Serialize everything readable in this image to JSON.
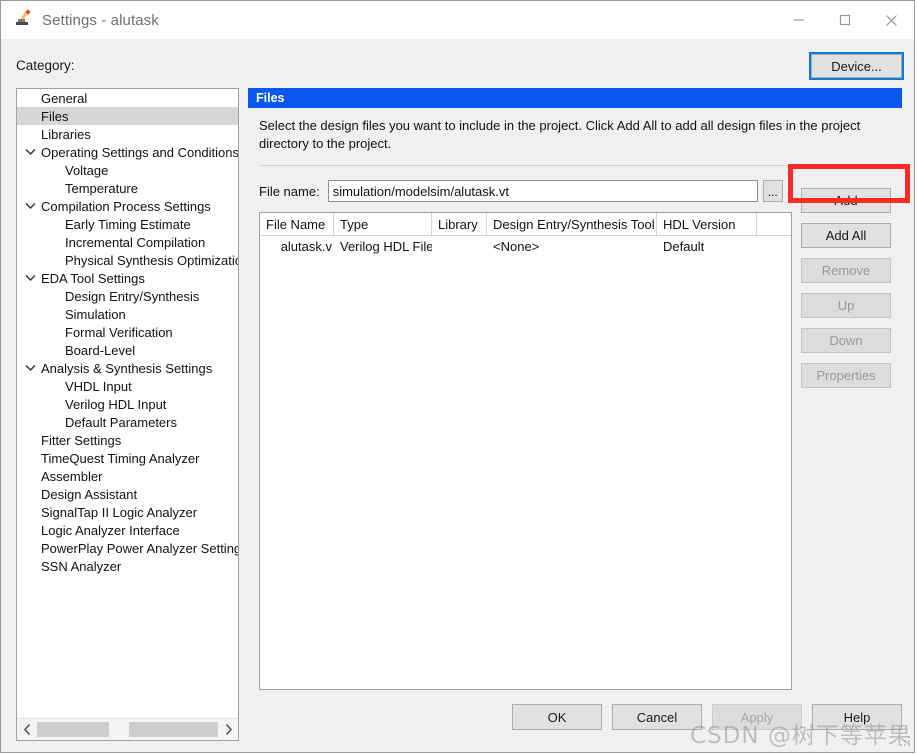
{
  "window": {
    "title": "Settings - alutask",
    "icon": "settings-pencil-icon",
    "minimize_label": "minimize-icon",
    "maximize_label": "maximize-icon",
    "close_label": "close-icon"
  },
  "category": {
    "label": "Category:",
    "items": [
      {
        "label": "General",
        "level": 0,
        "twisty": "none",
        "selected": false
      },
      {
        "label": "Files",
        "level": 0,
        "twisty": "none",
        "selected": true
      },
      {
        "label": "Libraries",
        "level": 0,
        "twisty": "none",
        "selected": false
      },
      {
        "label": "Operating Settings and Conditions",
        "level": 0,
        "twisty": "expanded",
        "selected": false
      },
      {
        "label": "Voltage",
        "level": 1,
        "twisty": "none",
        "selected": false
      },
      {
        "label": "Temperature",
        "level": 1,
        "twisty": "none",
        "selected": false
      },
      {
        "label": "Compilation Process Settings",
        "level": 0,
        "twisty": "expanded",
        "selected": false
      },
      {
        "label": "Early Timing Estimate",
        "level": 1,
        "twisty": "none",
        "selected": false
      },
      {
        "label": "Incremental Compilation",
        "level": 1,
        "twisty": "none",
        "selected": false
      },
      {
        "label": "Physical Synthesis Optimization",
        "level": 1,
        "twisty": "none",
        "selected": false
      },
      {
        "label": "EDA Tool Settings",
        "level": 0,
        "twisty": "expanded",
        "selected": false
      },
      {
        "label": "Design Entry/Synthesis",
        "level": 1,
        "twisty": "none",
        "selected": false
      },
      {
        "label": "Simulation",
        "level": 1,
        "twisty": "none",
        "selected": false
      },
      {
        "label": "Formal Verification",
        "level": 1,
        "twisty": "none",
        "selected": false
      },
      {
        "label": "Board-Level",
        "level": 1,
        "twisty": "none",
        "selected": false
      },
      {
        "label": "Analysis & Synthesis Settings",
        "level": 0,
        "twisty": "expanded",
        "selected": false
      },
      {
        "label": "VHDL Input",
        "level": 1,
        "twisty": "none",
        "selected": false
      },
      {
        "label": "Verilog HDL Input",
        "level": 1,
        "twisty": "none",
        "selected": false
      },
      {
        "label": "Default Parameters",
        "level": 1,
        "twisty": "none",
        "selected": false
      },
      {
        "label": "Fitter Settings",
        "level": 0,
        "twisty": "none",
        "selected": false
      },
      {
        "label": "TimeQuest Timing Analyzer",
        "level": 0,
        "twisty": "none",
        "selected": false
      },
      {
        "label": "Assembler",
        "level": 0,
        "twisty": "none",
        "selected": false
      },
      {
        "label": "Design Assistant",
        "level": 0,
        "twisty": "none",
        "selected": false
      },
      {
        "label": "SignalTap II Logic Analyzer",
        "level": 0,
        "twisty": "none",
        "selected": false
      },
      {
        "label": "Logic Analyzer Interface",
        "level": 0,
        "twisty": "none",
        "selected": false
      },
      {
        "label": "PowerPlay Power Analyzer Settings",
        "level": 0,
        "twisty": "none",
        "selected": false
      },
      {
        "label": "SSN Analyzer",
        "level": 0,
        "twisty": "none",
        "selected": false
      }
    ],
    "scroll_left_icon": "chevron-left-icon",
    "scroll_right_icon": "chevron-right-icon"
  },
  "device_button": {
    "label": "Device...",
    "focused": true,
    "focus_color": "#0a7ad8"
  },
  "files_panel": {
    "title": "Files",
    "title_bg": "#0a58f0",
    "description": "Select the design files you want to include in the project. Click Add All to add all design files in the project directory to the project.",
    "file_name": {
      "label": "File name:",
      "value": "simulation/modelsim/alutask.vt",
      "placeholder": "",
      "browse_label": "..."
    },
    "table": {
      "columns": [
        "File Name",
        "Type",
        "Library",
        "Design Entry/Synthesis Tool",
        "HDL Version",
        ""
      ],
      "rows": [
        {
          "file_name": "alutask.v",
          "type": "Verilog HDL File",
          "library": "",
          "tool": "<None>",
          "hdl_version": "Default",
          "extra": ""
        }
      ]
    },
    "side_buttons": [
      {
        "label": "Add",
        "enabled": true,
        "highlighted": true
      },
      {
        "label": "Add All",
        "enabled": true,
        "highlighted": false
      },
      {
        "label": "Remove",
        "enabled": false,
        "highlighted": false
      },
      {
        "label": "Up",
        "enabled": false,
        "highlighted": false
      },
      {
        "label": "Down",
        "enabled": false,
        "highlighted": false
      },
      {
        "label": "Properties",
        "enabled": false,
        "highlighted": false
      }
    ],
    "highlight_color": "#fc2b24"
  },
  "bottom_buttons": [
    {
      "label": "OK",
      "enabled": true
    },
    {
      "label": "Cancel",
      "enabled": true
    },
    {
      "label": "Apply",
      "enabled": false
    },
    {
      "label": "Help",
      "enabled": true
    }
  ],
  "watermark": {
    "text": "CSDN @树下等苹果"
  }
}
